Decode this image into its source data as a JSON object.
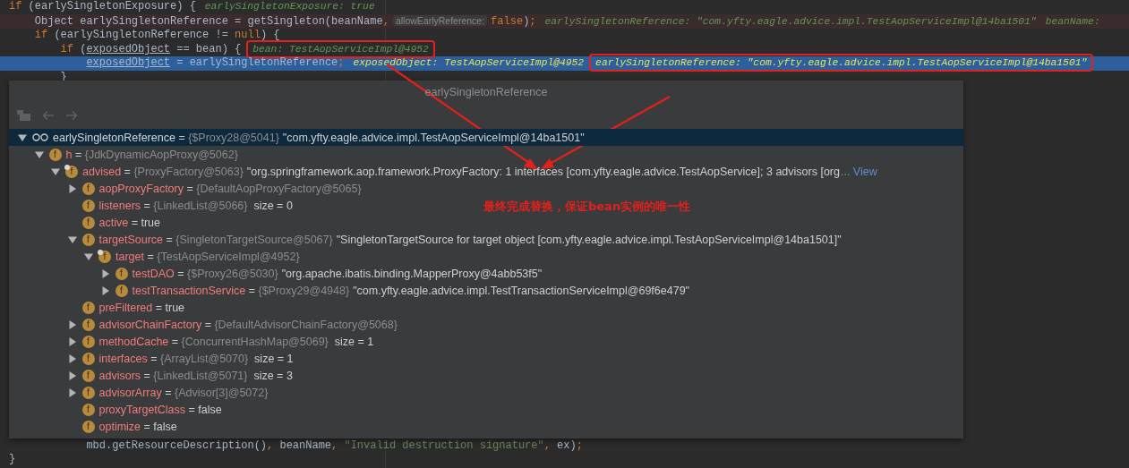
{
  "editor": {
    "lines_top": [
      {
        "kind": "normal",
        "segments": [
          {
            "kind": "code",
            "tokens": [
              {
                "t": "if",
                "kind": "kw"
              },
              {
                "t": " (earlySingletonExposure) {",
                "kind": "plain"
              }
            ]
          },
          {
            "kind": "hint",
            "text": "earlySingletonExposure: true",
            "boxed": false
          }
        ]
      },
      {
        "kind": "breakpoint",
        "segments": [
          {
            "kind": "code",
            "tokens": [
              {
                "t": "    Object earlySingletonReference = getSingleton(beanName",
                "kind": "plain"
              },
              {
                "t": ",",
                "kind": "kw"
              }
            ]
          },
          {
            "kind": "param",
            "text": "allowEarlyReference:"
          },
          {
            "kind": "code",
            "tokens": [
              {
                "t": "false",
                "kind": "kw"
              },
              {
                "t": ")",
                "kind": "plain"
              },
              {
                "t": ";",
                "kind": "kw"
              }
            ]
          },
          {
            "kind": "hint",
            "text": "earlySingletonReference: \"com.yfty.eagle.advice.impl.TestAopServiceImpl@14ba1501\"",
            "boxed": false
          },
          {
            "kind": "hint",
            "text": "beanName:",
            "boxed": false
          }
        ]
      },
      {
        "kind": "normal",
        "segments": [
          {
            "kind": "code",
            "tokens": [
              {
                "t": "    if",
                "kind": "kw"
              },
              {
                "t": " (earlySingletonReference != ",
                "kind": "plain"
              },
              {
                "t": "null",
                "kind": "kw"
              },
              {
                "t": ") {",
                "kind": "plain"
              }
            ]
          }
        ]
      },
      {
        "kind": "normal",
        "segments": [
          {
            "kind": "code",
            "tokens": [
              {
                "t": "        if",
                "kind": "kw"
              },
              {
                "t": " (",
                "kind": "plain"
              },
              {
                "t": "exposedObject",
                "kind": "var"
              },
              {
                "t": " == bean) {",
                "kind": "plain"
              }
            ]
          },
          {
            "kind": "hint",
            "text": "bean: TestAopServiceImpl@4952",
            "boxed": true
          }
        ]
      },
      {
        "kind": "current",
        "segments": [
          {
            "kind": "code",
            "tokens": [
              {
                "t": "            exposedObject",
                "kind": "var"
              },
              {
                "t": " = earlySingletonReference",
                "kind": "plain"
              },
              {
                "t": ";",
                "kind": "kw"
              }
            ]
          },
          {
            "kind": "hint",
            "text": "exposedObject: TestAopServiceImpl@4952",
            "boxed": false
          },
          {
            "kind": "hint",
            "text": "earlySingletonReference: \"com.yfty.eagle.advice.impl.TestAopServiceImpl@14ba1501\"",
            "boxed": true
          }
        ]
      },
      {
        "kind": "normal",
        "segments": [
          {
            "kind": "code",
            "tokens": [
              {
                "t": "        }",
                "kind": "plain"
              }
            ]
          }
        ]
      }
    ],
    "lines_bottom": [
      {
        "segments": [
          {
            "kind": "code",
            "tokens": [
              {
                "t": "            mbd.getResourceDescription()",
                "kind": "plain"
              },
              {
                "t": ",",
                "kind": "kw"
              },
              {
                "t": " beanName",
                "kind": "plain"
              },
              {
                "t": ", ",
                "kind": "kw"
              },
              {
                "t": "\"Invalid destruction signature\"",
                "kind": "str"
              },
              {
                "t": ",",
                "kind": "kw"
              },
              {
                "t": " ex)",
                "kind": "plain"
              },
              {
                "t": ";",
                "kind": "kw"
              }
            ]
          }
        ]
      },
      {
        "segments": [
          {
            "kind": "code",
            "tokens": [
              {
                "t": "}",
                "kind": "plain"
              }
            ]
          }
        ]
      }
    ]
  },
  "popup": {
    "title": "earlySingletonReference",
    "assign": "=",
    "tree": [
      {
        "kind": "watch",
        "name": "earlySingletonReference",
        "ref": "{$Proxy28@5041}",
        "value": "\"com.yfty.eagle.advice.impl.TestAopServiceImpl@14ba1501\"",
        "selected": true,
        "expanded": true,
        "children": [
          {
            "kind": "field",
            "badge": "f",
            "marked": false,
            "name": "h",
            "ref": "{JdkDynamicAopProxy@5062}",
            "selected": false,
            "expanded": true,
            "children": [
              {
                "kind": "field",
                "badge": "f",
                "marked": true,
                "name": "advised",
                "ref": "{ProxyFactory@5063}",
                "value": "\"org.springframework.aop.framework.ProxyFactory: 1 interfaces [com.yfty.eagle.advice.TestAopService]; 3 advisors [org",
                "link": "... View",
                "selected": false,
                "expanded": true,
                "children": [
                  {
                    "kind": "field",
                    "badge": "f",
                    "marked": false,
                    "name": "aopProxyFactory",
                    "ref": "{DefaultAopProxyFactory@5065}",
                    "selected": false,
                    "expanded": false
                  },
                  {
                    "kind": "field",
                    "badge": "f",
                    "marked": false,
                    "name": "listeners",
                    "ref": "{LinkedList@5066}",
                    "size": "size = 0",
                    "selected": false
                  },
                  {
                    "kind": "field",
                    "badge": "f",
                    "marked": false,
                    "name": "active",
                    "value": "true",
                    "selected": false
                  },
                  {
                    "kind": "field",
                    "badge": "f",
                    "marked": false,
                    "name": "targetSource",
                    "ref": "{SingletonTargetSource@5067}",
                    "value": "\"SingletonTargetSource for target object [com.yfty.eagle.advice.impl.TestAopServiceImpl@14ba1501]\"",
                    "selected": false,
                    "expanded": true,
                    "children": [
                      {
                        "kind": "field",
                        "badge": "f",
                        "marked": true,
                        "name": "target",
                        "ref": "{TestAopServiceImpl@4952}",
                        "selected": false,
                        "expanded": true,
                        "children": [
                          {
                            "kind": "field",
                            "badge": "f",
                            "marked": false,
                            "name": "testDAO",
                            "ref": "{$Proxy26@5030}",
                            "value": "\"org.apache.ibatis.binding.MapperProxy@4abb53f5\"",
                            "selected": false,
                            "expanded": false
                          },
                          {
                            "kind": "field",
                            "badge": "f",
                            "marked": false,
                            "name": "testTransactionService",
                            "ref": "{$Proxy29@4948}",
                            "value": "\"com.yfty.eagle.advice.impl.TestTransactionServiceImpl@69f6e479\"",
                            "selected": false,
                            "expanded": false
                          }
                        ]
                      }
                    ]
                  },
                  {
                    "kind": "field",
                    "badge": "f",
                    "marked": false,
                    "name": "preFiltered",
                    "value": "true",
                    "selected": false
                  },
                  {
                    "kind": "field",
                    "badge": "f",
                    "marked": false,
                    "name": "advisorChainFactory",
                    "ref": "{DefaultAdvisorChainFactory@5068}",
                    "selected": false,
                    "expanded": false
                  },
                  {
                    "kind": "field",
                    "badge": "f",
                    "marked": false,
                    "name": "methodCache",
                    "ref": "{ConcurrentHashMap@5069}",
                    "size": "size = 1",
                    "selected": false,
                    "expanded": false
                  },
                  {
                    "kind": "field",
                    "badge": "f",
                    "marked": false,
                    "name": "interfaces",
                    "ref": "{ArrayList@5070}",
                    "size": "size = 1",
                    "selected": false,
                    "expanded": false
                  },
                  {
                    "kind": "field",
                    "badge": "f",
                    "marked": false,
                    "name": "advisors",
                    "ref": "{LinkedList@5071}",
                    "size": "size = 3",
                    "selected": false,
                    "expanded": false
                  },
                  {
                    "kind": "field",
                    "badge": "f",
                    "marked": false,
                    "name": "advisorArray",
                    "ref": "{Advisor[3]@5072}",
                    "selected": false,
                    "expanded": false
                  },
                  {
                    "kind": "field",
                    "badge": "f",
                    "marked": false,
                    "name": "proxyTargetClass",
                    "value": "false",
                    "selected": false
                  },
                  {
                    "kind": "field",
                    "badge": "f",
                    "marked": false,
                    "name": "optimize",
                    "value": "false",
                    "selected": false
                  }
                ]
              }
            ]
          }
        ]
      }
    ]
  },
  "annotation": {
    "note": "最终完成替换，保证bean实例的唯一性"
  }
}
